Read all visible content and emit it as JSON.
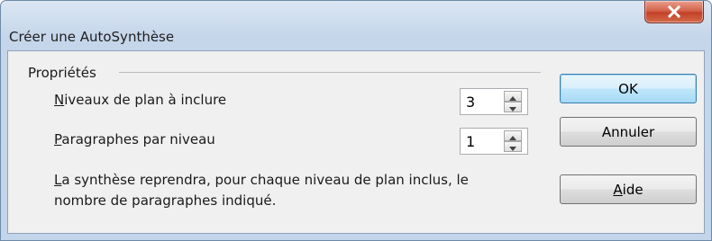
{
  "window": {
    "title": "Créer une AutoSynthèse"
  },
  "group": {
    "label": "Propriétés"
  },
  "levels": {
    "mnemonic": "N",
    "label_rest": "iveaux de plan à inclure",
    "value": "3"
  },
  "paragraphs": {
    "mnemonic": "P",
    "label_rest": "aragraphes par niveau",
    "value": "1"
  },
  "description": {
    "mnemonic": "L",
    "line1_rest": "a synthèse reprendra, pour chaque niveau de plan inclus, le",
    "line2": "nombre de paragraphes indiqué."
  },
  "buttons": {
    "ok": "OK",
    "cancel": "Annuler",
    "help_mnemonic": "A",
    "help_rest": "ide"
  },
  "icons": {
    "close": "close-icon",
    "spin_up": "arrow-up-icon",
    "spin_down": "arrow-down-icon"
  }
}
